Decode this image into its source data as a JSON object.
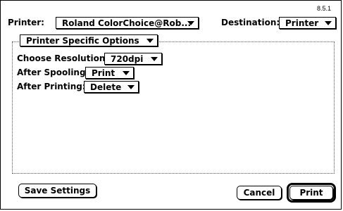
{
  "dialog": {
    "version": "8.5.1",
    "printer_label": "Printer:",
    "printer_value": "Roland ColorChoice@Rob...",
    "destination_label": "Destination:",
    "destination_value": "Printer",
    "section_menu": "Printer Specific Options",
    "options": {
      "resolution_label": "Choose Resolution:",
      "resolution_value": "720dpi",
      "after_spooling_label": "After Spooling:",
      "after_spooling_value": "Print",
      "after_printing_label": "After Printing:",
      "after_printing_value": "Delete"
    },
    "buttons": {
      "save_settings": "Save Settings",
      "cancel": "Cancel",
      "print": "Print"
    }
  }
}
